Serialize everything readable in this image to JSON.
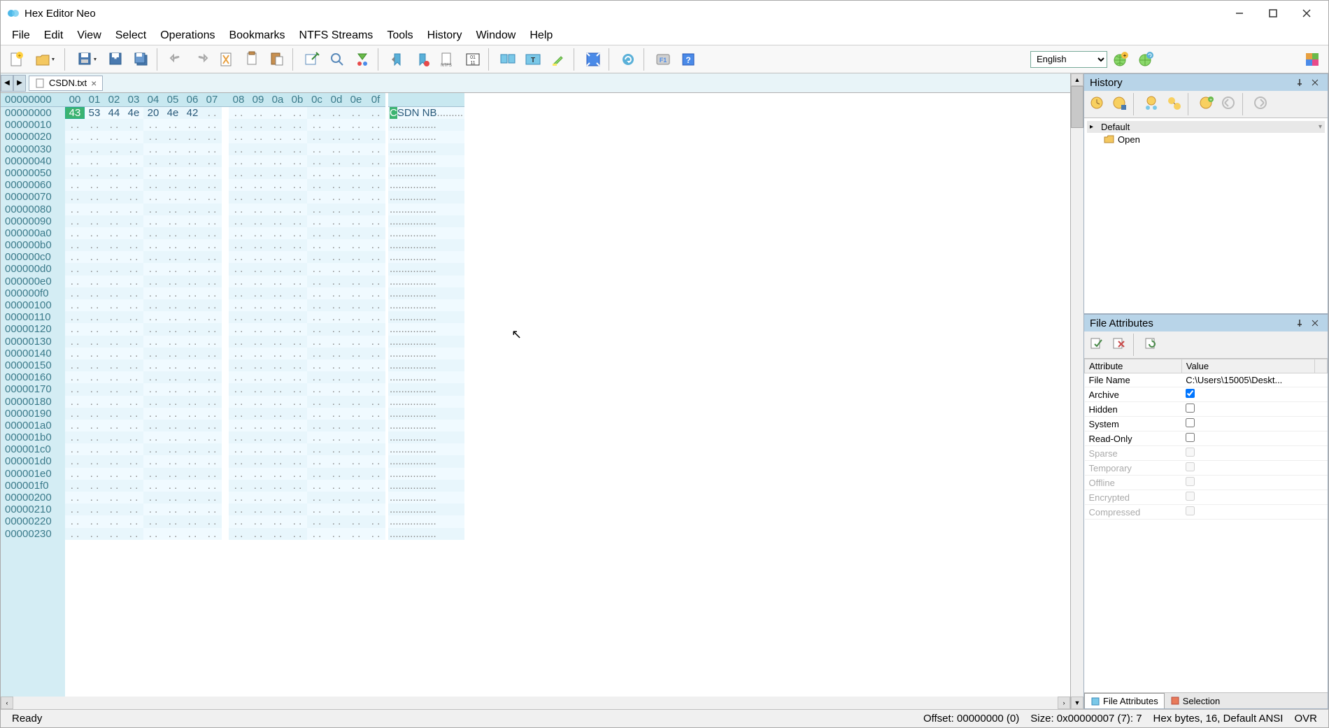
{
  "app": {
    "title": "Hex Editor Neo",
    "language": "English"
  },
  "menu": [
    "File",
    "Edit",
    "View",
    "Select",
    "Operations",
    "Bookmarks",
    "NTFS Streams",
    "Tools",
    "History",
    "Window",
    "Help"
  ],
  "tab": {
    "filename": "CSDN.txt"
  },
  "hex": {
    "header_offset": "00000000",
    "cols": [
      "00",
      "01",
      "02",
      "03",
      "04",
      "05",
      "06",
      "07",
      "08",
      "09",
      "0a",
      "0b",
      "0c",
      "0d",
      "0e",
      "0f"
    ],
    "offsets": [
      "00000000",
      "00000010",
      "00000020",
      "00000030",
      "00000040",
      "00000050",
      "00000060",
      "00000070",
      "00000080",
      "00000090",
      "000000a0",
      "000000b0",
      "000000c0",
      "000000d0",
      "000000e0",
      "000000f0",
      "00000100",
      "00000110",
      "00000120",
      "00000130",
      "00000140",
      "00000150",
      "00000160",
      "00000170",
      "00000180",
      "00000190",
      "000001a0",
      "000001b0",
      "000001c0",
      "000001d0",
      "000001e0",
      "000001f0",
      "00000200",
      "00000210",
      "00000220",
      "00000230"
    ],
    "row0": {
      "bytes": [
        "43",
        "53",
        "44",
        "4e",
        "20",
        "4e",
        "42"
      ],
      "selected_index": 0,
      "ascii": "CSDN NB",
      "ascii_sel": "C"
    },
    "empty_cell": ". .",
    "empty_ascii": "................"
  },
  "history": {
    "title": "History",
    "root": "Default",
    "items": [
      "Open"
    ]
  },
  "attrs": {
    "title": "File Attributes",
    "cols": [
      "Attribute",
      "Value"
    ],
    "filename_label": "File Name",
    "filename_value": "C:\\Users\\15005\\Deskt...",
    "rows": [
      {
        "label": "Archive",
        "checked": true,
        "disabled": false
      },
      {
        "label": "Hidden",
        "checked": false,
        "disabled": false
      },
      {
        "label": "System",
        "checked": false,
        "disabled": false
      },
      {
        "label": "Read-Only",
        "checked": false,
        "disabled": false
      },
      {
        "label": "Sparse",
        "checked": false,
        "disabled": true
      },
      {
        "label": "Temporary",
        "checked": false,
        "disabled": true
      },
      {
        "label": "Offline",
        "checked": false,
        "disabled": true
      },
      {
        "label": "Encrypted",
        "checked": false,
        "disabled": true
      },
      {
        "label": "Compressed",
        "checked": false,
        "disabled": true
      }
    ]
  },
  "bottom_tabs": {
    "file_attrs": "File Attributes",
    "selection": "Selection"
  },
  "status": {
    "ready": "Ready",
    "offset": "Offset: 00000000 (0)",
    "size": "Size: 0x00000007 (7): 7",
    "mode": "Hex bytes, 16, Default ANSI",
    "ovr": "OVR"
  }
}
